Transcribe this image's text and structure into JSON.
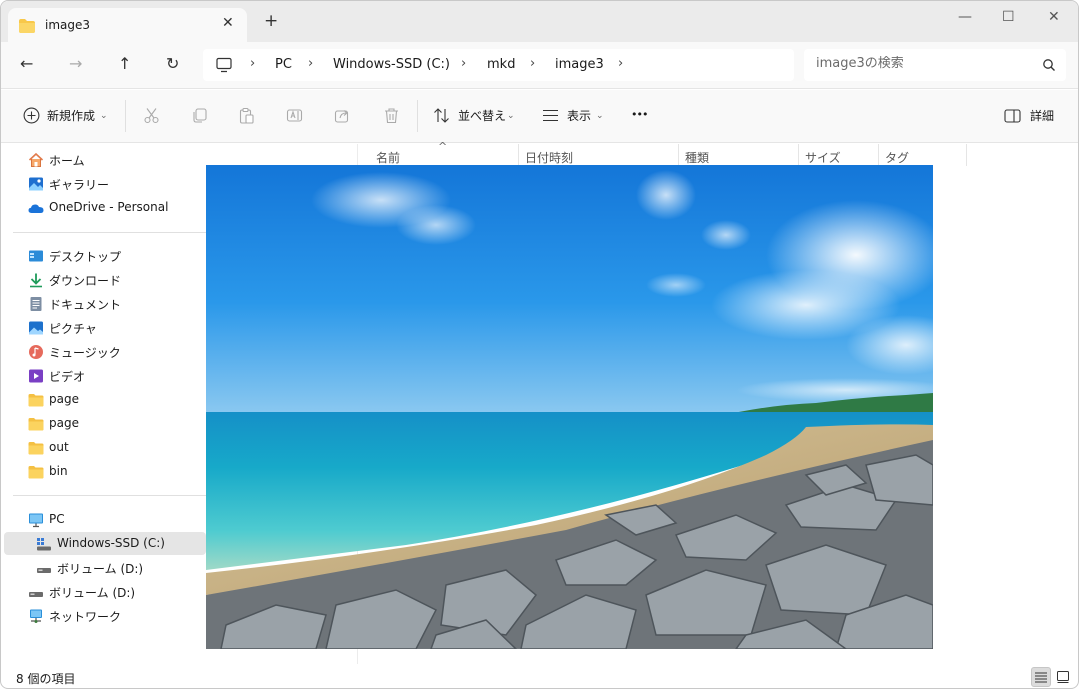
{
  "tab": {
    "title": "image3",
    "close": "✕",
    "new_tab": "+"
  },
  "window_controls": {
    "minimize": "—",
    "maximize": "☐",
    "close": "✕"
  },
  "nav": {
    "back": "←",
    "forward": "→",
    "up": "↑",
    "refresh": "↻"
  },
  "breadcrumb": [
    "PC",
    "Windows-SSD (C:)",
    "mkd",
    "image3"
  ],
  "breadcrumb_sep": "›",
  "search": {
    "placeholder": "image3の検索"
  },
  "commands": {
    "new": "新規作成",
    "sort": "並べ替え",
    "view": "表示",
    "more": "•••",
    "details": "詳細"
  },
  "columns": [
    "名前",
    "日付時刻",
    "種類",
    "サイズ",
    "タグ"
  ],
  "sort_indicator": "^",
  "sidebar": {
    "quick": [
      {
        "label": "ホーム",
        "icon": "home-icon"
      },
      {
        "label": "ギャラリー",
        "icon": "gallery-icon"
      },
      {
        "label": "OneDrive - Personal",
        "icon": "onedrive-icon"
      }
    ],
    "pinned": [
      {
        "label": "デスクトップ",
        "icon": "desktop-icon"
      },
      {
        "label": "ダウンロード",
        "icon": "download-icon"
      },
      {
        "label": "ドキュメント",
        "icon": "document-icon"
      },
      {
        "label": "ピクチャ",
        "icon": "pictures-icon"
      },
      {
        "label": "ミュージック",
        "icon": "music-icon"
      },
      {
        "label": "ビデオ",
        "icon": "video-icon"
      },
      {
        "label": "page",
        "icon": "folder-icon"
      },
      {
        "label": "page",
        "icon": "folder-icon"
      },
      {
        "label": "out",
        "icon": "folder-icon"
      },
      {
        "label": "bin",
        "icon": "folder-icon"
      }
    ],
    "devices": [
      {
        "label": "PC",
        "icon": "pc-icon"
      },
      {
        "label": "Windows-SSD (C:)",
        "icon": "drive-icon"
      },
      {
        "label": "ボリューム (D:)",
        "icon": "drive-icon"
      },
      {
        "label": "ボリューム (D:)",
        "icon": "drive-icon"
      },
      {
        "label": "ネットワーク",
        "icon": "network-icon"
      }
    ]
  },
  "status": {
    "item_count": "8 個の項目"
  },
  "colors": {
    "accent": "#0067c0",
    "folder": "#f8c84a",
    "selected": "#e5e5e5"
  }
}
